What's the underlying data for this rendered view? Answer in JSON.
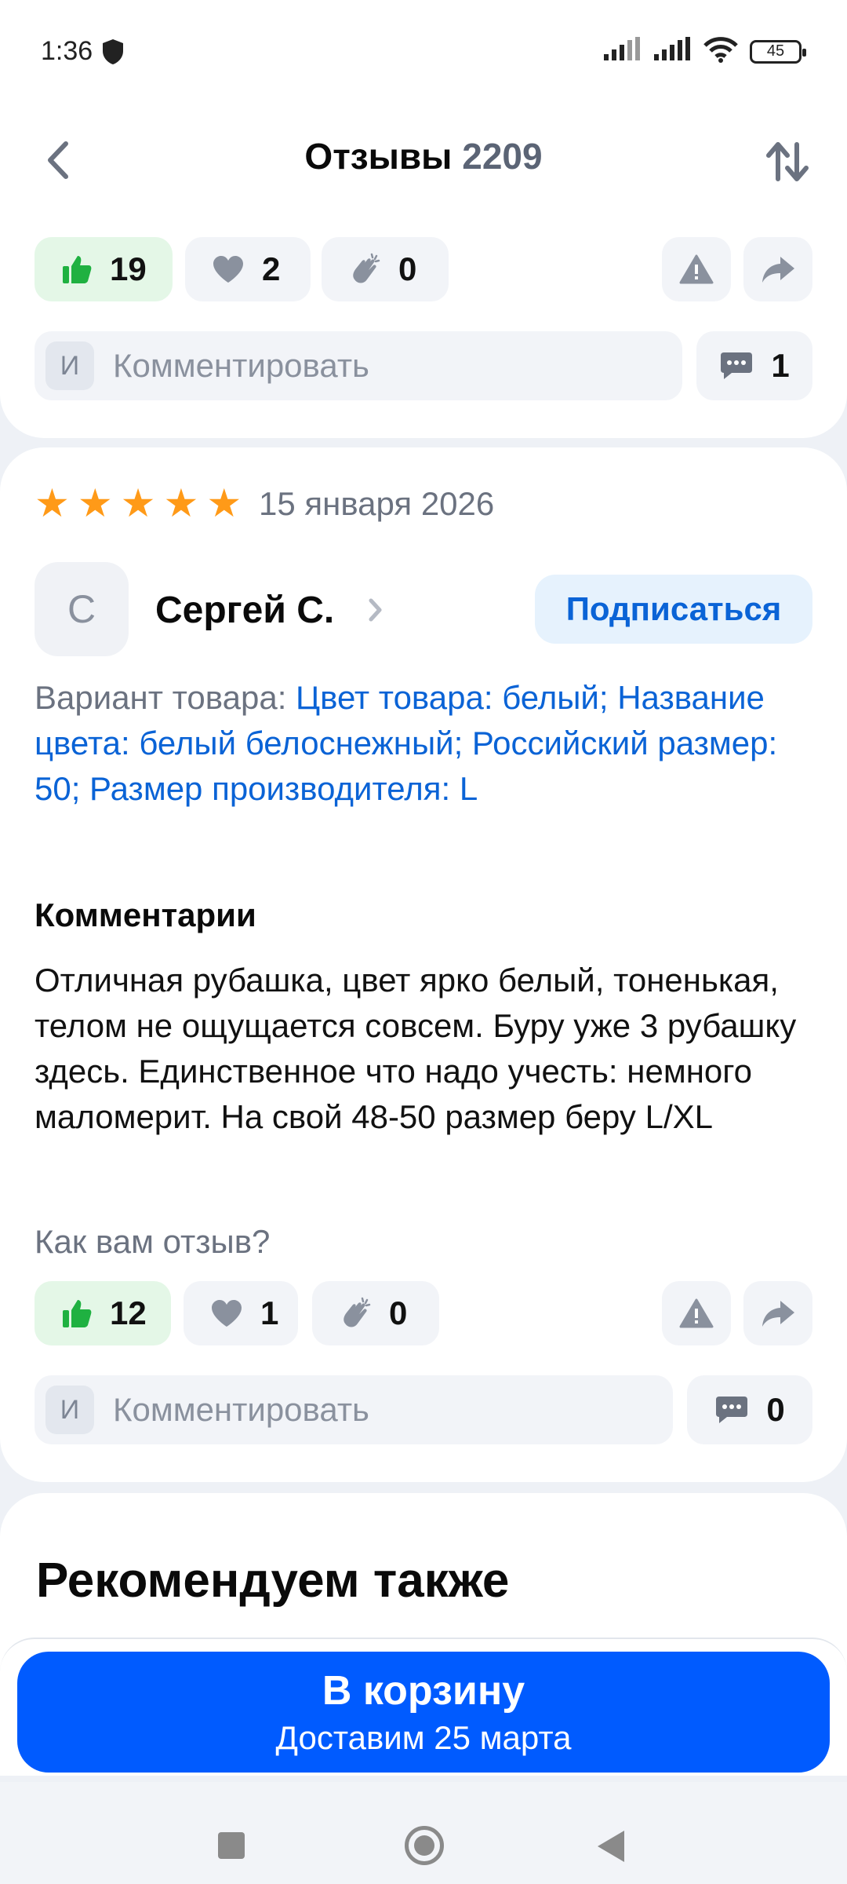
{
  "status_bar": {
    "time": "1:36",
    "battery": "45"
  },
  "header": {
    "title": "Отзывы",
    "count": "2209"
  },
  "prev_review": {
    "likes": "19",
    "hearts": "2",
    "claps": "0",
    "comment_avatar": "И",
    "comment_placeholder": "Комментировать",
    "comments_count": "1"
  },
  "review": {
    "date": "15 января 2026",
    "author_initial": "С",
    "author_name": "Сергей С.",
    "subscribe_label": "Подписаться",
    "variant_prefix": "Вариант товара:",
    "variant_value": "Цвет товара: белый; Название цвета: белый белоснежный; Российский размер: 50; Размер производителя: L",
    "comments_title": "Комментарии",
    "text": "Отличная рубашка, цвет ярко белый, тоненькая, телом не ощущается совсем. Буру уже 3 рубашку здесь. Единственное что надо учесть: немного маломерит. На свой 48-50 размер беру L/XL",
    "rate_question": "Как вам отзыв?",
    "likes": "12",
    "hearts": "1",
    "claps": "0",
    "comment_avatar": "И",
    "comment_placeholder": "Комментировать",
    "comments_count": "0",
    "rating": 5
  },
  "recommend": {
    "title": "Рекомендуем также"
  },
  "cart": {
    "label": "В корзину",
    "delivery": "Доставим 25 марта"
  },
  "colors": {
    "accent": "#005bff",
    "link": "#0a63d6",
    "star": "#ff9a18",
    "like_bg": "#e4f7e7",
    "like_icon": "#1fb141"
  }
}
